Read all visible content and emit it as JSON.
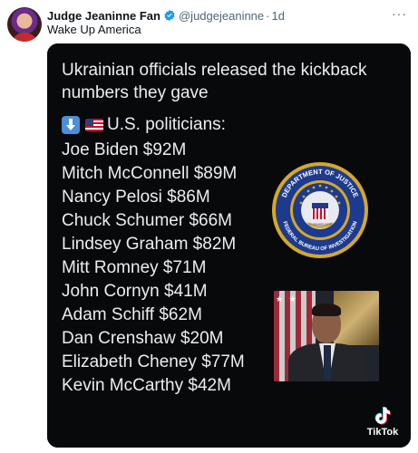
{
  "tweet": {
    "author_name": "Judge Jeaninne Fan",
    "handle": "@judgejeaninne",
    "separator": "·",
    "time": "1d",
    "more_label": "···",
    "text": "Wake Up America"
  },
  "media": {
    "headline": "Ukrainian officials released the kickback numbers they gave",
    "subhead": "U.S. politicians:",
    "items": [
      "Joe Biden $92M",
      "Mitch McConnell $89M",
      "Nancy Pelosi $86M",
      "Chuck Schumer $66M",
      "Lindsey Graham $82M",
      "Mitt Romney $71M",
      "John Cornyn $41M",
      "Adam Schiff $62M",
      "Dan Crenshaw $20M",
      "Elizabeth Cheney $77M",
      "Kevin McCarthy $42M"
    ],
    "seal_text_top": "DEPARTMENT OF JUSTICE",
    "seal_text_bottom": "FEDERAL BUREAU OF INVESTIGATION",
    "seal_banner": "FIDELITY BRAVERY INTEGRITY",
    "watermark": "TikTok",
    "icons": [
      "down-arrow-icon",
      "us-flag-icon",
      "verified-icon",
      "tiktok-icon",
      "fbi-seal-icon"
    ]
  },
  "colors": {
    "verified_blue": "#1d9bf0",
    "media_background": "#08090b",
    "media_text": "#ecedf0",
    "secondary_text": "#536471"
  }
}
